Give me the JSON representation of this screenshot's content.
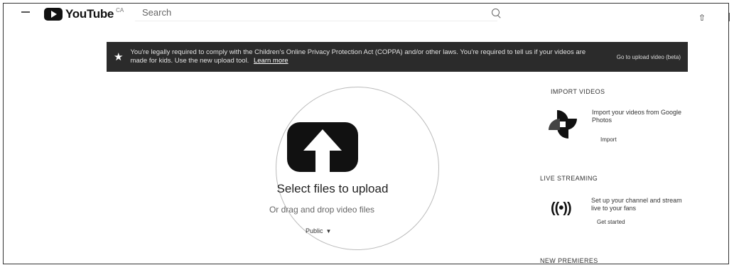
{
  "header": {
    "logo_text": "YouTube",
    "logo_super": "CA",
    "search_placeholder": "Search"
  },
  "banner": {
    "text": "You're legally required to comply with the Children's Online Privacy Protection Act (COPPA) and/or other laws. You're required to tell us if your videos are made for kids. Use the new upload tool.",
    "link": "Learn more",
    "button": "Go to upload video (beta)"
  },
  "upload": {
    "title": "Select files to upload",
    "subtitle": "Or drag and drop video files",
    "privacy": "Public",
    "caret": "▼"
  },
  "sidebar": {
    "import": {
      "heading": "IMPORT VIDEOS",
      "description": "Import your videos from Google Photos",
      "button": "Import"
    },
    "live": {
      "heading": "LIVE STREAMING",
      "icon": "((•))",
      "description": "Set up your channel and stream live to your fans",
      "button": "Get started"
    },
    "premieres": {
      "heading": "NEW PREMIERES"
    }
  },
  "icons": {
    "star": "★",
    "upload": "⇧"
  }
}
